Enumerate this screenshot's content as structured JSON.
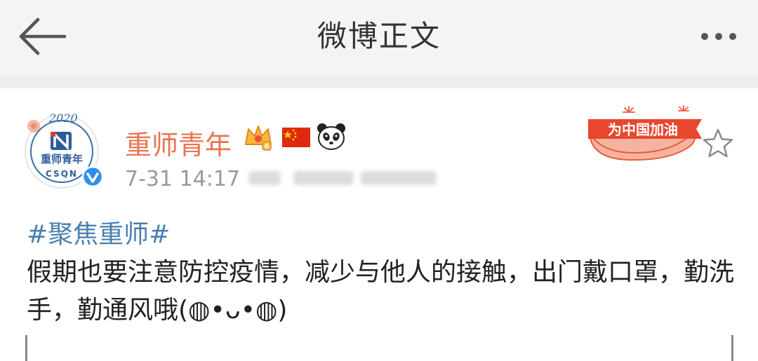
{
  "navbar": {
    "title": "微博正文",
    "back_icon": "arrow-left-icon",
    "more_icon": "ellipsis-icon"
  },
  "post": {
    "author": {
      "name": "重师青年",
      "avatar_text_top": "重师青年",
      "avatar_text_bottom": "CSQN",
      "avatar_year": "2020",
      "verified_icon": "verified-check-icon",
      "badges": [
        "crown-vip-icon",
        "china-flag-icon",
        "panda-icon"
      ]
    },
    "time": "7-31 14:17",
    "cheer_badge": "为中国加油",
    "favorite_icon": "star-outline-icon",
    "topic": "#聚焦重师#",
    "text": "假期也要注意防控疫情，减少与他人的接触，出门戴口罩，勤洗手，勤通风哦(◍•ᴗ•◍)"
  },
  "colors": {
    "username": "#eb7350",
    "topic": "#4a7fb0",
    "nav_bg": "#f4f4f4",
    "text": "#222222",
    "meta": "#999999"
  }
}
